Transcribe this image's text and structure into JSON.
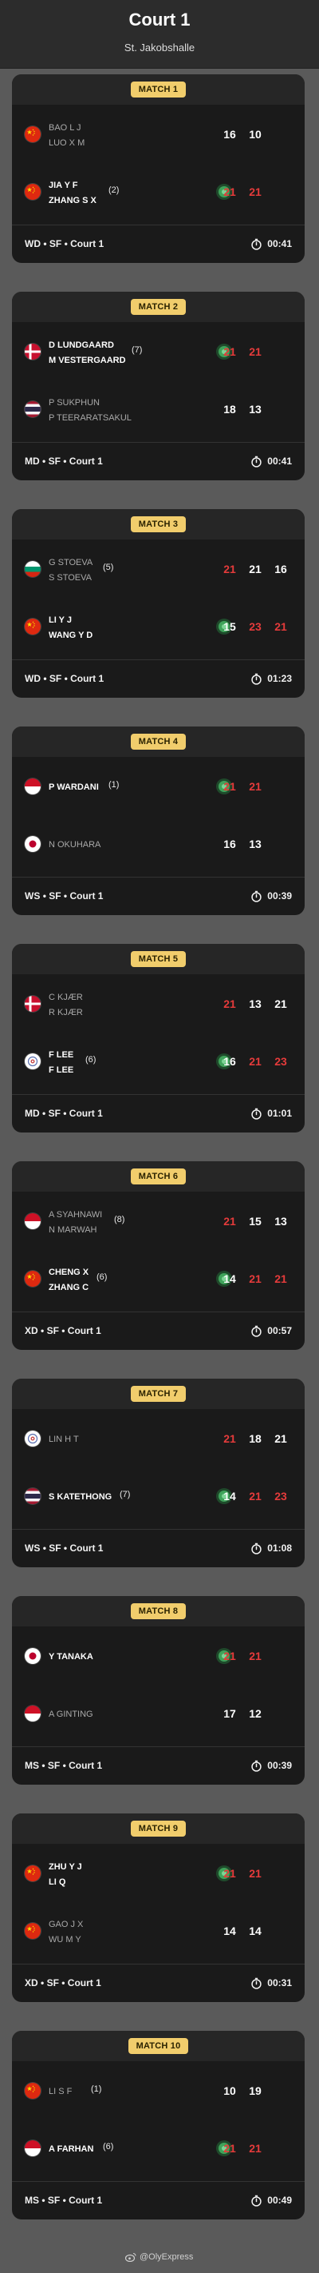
{
  "header": {
    "title": "Court 1",
    "subtitle": "St. Jakobshalle"
  },
  "colors": {
    "winning_game": "#e53b3b",
    "badge": "#f1cd6c",
    "serve_dot": "#3fa35a"
  },
  "matches": [
    {
      "label": "MATCH 1",
      "event": "WD",
      "round": "SF",
      "court": "Court 1",
      "duration": "00:41",
      "teams": [
        {
          "flag": "china",
          "names": [
            "BAO L J",
            "LUO X M"
          ],
          "seed": "",
          "winner": false,
          "serving": false,
          "scores": [
            "16",
            "10",
            ""
          ],
          "won": [
            false,
            false,
            false
          ]
        },
        {
          "flag": "china",
          "names": [
            "JIA Y F",
            "ZHANG S X"
          ],
          "seed": "(2)",
          "winner": true,
          "serving": true,
          "scores": [
            "21",
            "21",
            ""
          ],
          "won": [
            true,
            true,
            false
          ]
        }
      ]
    },
    {
      "label": "MATCH 2",
      "event": "MD",
      "round": "SF",
      "court": "Court 1",
      "duration": "00:41",
      "teams": [
        {
          "flag": "denmark",
          "names": [
            "D LUNDGAARD",
            "M VESTERGAARD"
          ],
          "seed": "(7)",
          "winner": true,
          "serving": true,
          "scores": [
            "21",
            "21",
            ""
          ],
          "won": [
            true,
            true,
            false
          ]
        },
        {
          "flag": "thailand",
          "names": [
            "P SUKPHUN",
            "P TEERARATSAKUL"
          ],
          "seed": "",
          "winner": false,
          "serving": false,
          "scores": [
            "18",
            "13",
            ""
          ],
          "won": [
            false,
            false,
            false
          ]
        }
      ]
    },
    {
      "label": "MATCH 3",
      "event": "WD",
      "round": "SF",
      "court": "Court 1",
      "duration": "01:23",
      "teams": [
        {
          "flag": "bulgaria",
          "names": [
            "G STOEVA",
            "S STOEVA"
          ],
          "seed": "(5)",
          "winner": false,
          "serving": false,
          "scores": [
            "21",
            "21",
            "16"
          ],
          "won": [
            true,
            false,
            false
          ]
        },
        {
          "flag": "china",
          "names": [
            "LI Y J",
            "WANG Y D"
          ],
          "seed": "",
          "winner": true,
          "serving": true,
          "scores": [
            "15",
            "23",
            "21"
          ],
          "won": [
            false,
            true,
            true
          ]
        }
      ]
    },
    {
      "label": "MATCH 4",
      "event": "WS",
      "round": "SF",
      "court": "Court 1",
      "duration": "00:39",
      "teams": [
        {
          "flag": "indonesia",
          "names": [
            "P WARDANI"
          ],
          "seed": "(1)",
          "winner": true,
          "serving": true,
          "scores": [
            "21",
            "21",
            ""
          ],
          "won": [
            true,
            true,
            false
          ]
        },
        {
          "flag": "japan",
          "names": [
            "N OKUHARA"
          ],
          "seed": "",
          "winner": false,
          "serving": false,
          "scores": [
            "16",
            "13",
            ""
          ],
          "won": [
            false,
            false,
            false
          ]
        }
      ]
    },
    {
      "label": "MATCH 5",
      "event": "MD",
      "round": "SF",
      "court": "Court 1",
      "duration": "01:01",
      "teams": [
        {
          "flag": "denmark",
          "names": [
            "C KJÆR",
            "R KJÆR"
          ],
          "seed": "",
          "winner": false,
          "serving": false,
          "scores": [
            "21",
            "13",
            "21"
          ],
          "won": [
            true,
            false,
            false
          ]
        },
        {
          "flag": "tpe",
          "names": [
            "F LEE",
            "F LEE"
          ],
          "seed": "(6)",
          "winner": true,
          "serving": true,
          "scores": [
            "16",
            "21",
            "23"
          ],
          "won": [
            false,
            true,
            true
          ]
        }
      ]
    },
    {
      "label": "MATCH 6",
      "event": "XD",
      "round": "SF",
      "court": "Court 1",
      "duration": "00:57",
      "teams": [
        {
          "flag": "indonesia",
          "names": [
            "A SYAHNAWI",
            "N MARWAH"
          ],
          "seed": "(8)",
          "winner": false,
          "serving": false,
          "scores": [
            "21",
            "15",
            "13"
          ],
          "won": [
            true,
            false,
            false
          ]
        },
        {
          "flag": "china",
          "names": [
            "CHENG X",
            "ZHANG C"
          ],
          "seed": "(6)",
          "winner": true,
          "serving": true,
          "scores": [
            "14",
            "21",
            "21"
          ],
          "won": [
            false,
            true,
            true
          ]
        }
      ]
    },
    {
      "label": "MATCH 7",
      "event": "WS",
      "round": "SF",
      "court": "Court 1",
      "duration": "01:08",
      "teams": [
        {
          "flag": "tpe",
          "names": [
            "LIN H T"
          ],
          "seed": "",
          "winner": false,
          "serving": false,
          "scores": [
            "21",
            "18",
            "21"
          ],
          "won": [
            true,
            false,
            false
          ]
        },
        {
          "flag": "thailand",
          "names": [
            "S KATETHONG"
          ],
          "seed": "(7)",
          "winner": true,
          "serving": true,
          "scores": [
            "14",
            "21",
            "23"
          ],
          "won": [
            false,
            true,
            true
          ]
        }
      ]
    },
    {
      "label": "MATCH 8",
      "event": "MS",
      "round": "SF",
      "court": "Court 1",
      "duration": "00:39",
      "teams": [
        {
          "flag": "japan",
          "names": [
            "Y TANAKA"
          ],
          "seed": "",
          "winner": true,
          "serving": true,
          "scores": [
            "21",
            "21",
            ""
          ],
          "won": [
            true,
            true,
            false
          ]
        },
        {
          "flag": "indonesia",
          "names": [
            "A GINTING"
          ],
          "seed": "",
          "winner": false,
          "serving": false,
          "scores": [
            "17",
            "12",
            ""
          ],
          "won": [
            false,
            false,
            false
          ]
        }
      ]
    },
    {
      "label": "MATCH 9",
      "event": "XD",
      "round": "SF",
      "court": "Court 1",
      "duration": "00:31",
      "teams": [
        {
          "flag": "china",
          "names": [
            "ZHU Y J",
            "LI Q"
          ],
          "seed": "",
          "winner": true,
          "serving": true,
          "scores": [
            "21",
            "21",
            ""
          ],
          "won": [
            true,
            true,
            false
          ]
        },
        {
          "flag": "china",
          "names": [
            "GAO J X",
            "WU M Y"
          ],
          "seed": "",
          "winner": false,
          "serving": false,
          "scores": [
            "14",
            "14",
            ""
          ],
          "won": [
            false,
            false,
            false
          ]
        }
      ]
    },
    {
      "label": "MATCH 10",
      "event": "MS",
      "round": "SF",
      "court": "Court 1",
      "duration": "00:49",
      "teams": [
        {
          "flag": "china",
          "names": [
            "LI S F"
          ],
          "seed": "(1)",
          "winner": false,
          "serving": false,
          "scores": [
            "10",
            "19",
            ""
          ],
          "won": [
            false,
            false,
            false
          ]
        },
        {
          "flag": "indonesia",
          "names": [
            "A FARHAN"
          ],
          "seed": "(6)",
          "winner": true,
          "serving": true,
          "scores": [
            "21",
            "21",
            ""
          ],
          "won": [
            true,
            true,
            false
          ]
        }
      ]
    }
  ],
  "watermark": {
    "text": "@OlyExpress",
    "icon": "weibo-icon"
  }
}
